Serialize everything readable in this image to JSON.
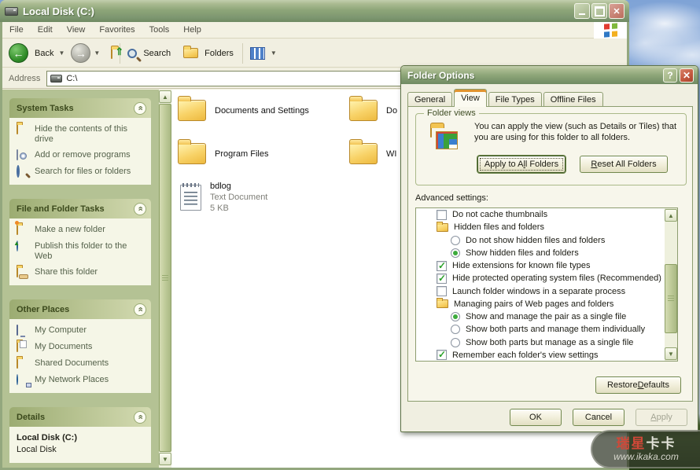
{
  "window": {
    "title": "Local Disk (C:)",
    "menu": [
      "File",
      "Edit",
      "View",
      "Favorites",
      "Tools",
      "Help"
    ],
    "toolbar": {
      "back_label": "Back",
      "search_label": "Search",
      "folders_label": "Folders"
    },
    "address": {
      "label": "Address",
      "value": "C:\\"
    }
  },
  "sidebar": {
    "sections": [
      {
        "title": "System Tasks",
        "items": [
          {
            "label": "Hide the contents of this drive"
          },
          {
            "label": "Add or remove programs"
          },
          {
            "label": "Search for files or folders"
          }
        ]
      },
      {
        "title": "File and Folder Tasks",
        "items": [
          {
            "label": "Make a new folder"
          },
          {
            "label": "Publish this folder to the Web"
          },
          {
            "label": "Share this folder"
          }
        ]
      },
      {
        "title": "Other Places",
        "items": [
          {
            "label": "My Computer"
          },
          {
            "label": "My Documents"
          },
          {
            "label": "Shared Documents"
          },
          {
            "label": "My Network Places"
          }
        ]
      },
      {
        "title": "Details",
        "detail_title": "Local Disk (C:)",
        "detail_sub": "Local Disk"
      }
    ]
  },
  "files": {
    "tiles": [
      {
        "name": "Documents and Settings"
      },
      {
        "name": "Do"
      },
      {
        "name": "Program Files"
      },
      {
        "name": "WI"
      },
      {
        "name": "bdlog",
        "meta1": "Text Document",
        "meta2": "5 KB"
      }
    ]
  },
  "dialog": {
    "title": "Folder Options",
    "tabs": [
      {
        "label": "General"
      },
      {
        "label": "View"
      },
      {
        "label": "File Types"
      },
      {
        "label": "Offline Files"
      }
    ],
    "active_tab": "View",
    "folder_views": {
      "legend": "Folder views",
      "description": "You can apply the view (such as Details or Tiles) that you are using for this folder to all folders.",
      "apply_button": {
        "label": "Apply to All Folders",
        "accel_index": 10
      },
      "reset_button": {
        "label": "Reset All Folders",
        "accel_index": 0
      }
    },
    "advanced": {
      "label": "Advanced settings:",
      "items": [
        {
          "control": "checkbox",
          "checked": false,
          "level": 1,
          "label": "Do not cache thumbnails"
        },
        {
          "control": "folder",
          "level": 1,
          "label": "Hidden files and folders"
        },
        {
          "control": "radio",
          "checked": false,
          "level": 2,
          "label": "Do not show hidden files and folders"
        },
        {
          "control": "radio",
          "checked": true,
          "level": 2,
          "label": "Show hidden files and folders"
        },
        {
          "control": "checkbox",
          "checked": true,
          "level": 1,
          "label": "Hide extensions for known file types"
        },
        {
          "control": "checkbox",
          "checked": true,
          "level": 1,
          "label": "Hide protected operating system files (Recommended)"
        },
        {
          "control": "checkbox",
          "checked": false,
          "level": 1,
          "label": "Launch folder windows in a separate process"
        },
        {
          "control": "folder",
          "level": 1,
          "label": "Managing pairs of Web pages and folders"
        },
        {
          "control": "radio",
          "checked": true,
          "level": 2,
          "label": "Show and manage the pair as a single file"
        },
        {
          "control": "radio",
          "checked": false,
          "level": 2,
          "label": "Show both parts and manage them individually"
        },
        {
          "control": "radio",
          "checked": false,
          "level": 2,
          "label": "Show both parts but manage as a single file"
        },
        {
          "control": "checkbox",
          "checked": true,
          "level": 1,
          "label": "Remember each folder's view settings"
        }
      ]
    },
    "buttons": {
      "restore": {
        "label": "Restore Defaults",
        "accel_index": 8
      },
      "ok": {
        "label": "OK"
      },
      "cancel": {
        "label": "Cancel"
      },
      "apply": {
        "label": "Apply",
        "accel_index": 0,
        "disabled": true
      }
    }
  },
  "watermark": {
    "brand_red": "瑞星",
    "brand_white": "卡卡",
    "url": "www.ikaka.com"
  },
  "colors": {
    "titlebar_top": "#c3cfae",
    "titlebar_mid": "#8ea679",
    "titlebar_bottom": "#6f8a62",
    "window_chrome": "#f0eede",
    "window_border": "#93a77e",
    "sidebar_bg": "#b4c294",
    "section_header_left": "#9cac72",
    "section_header_right": "#d4dbb2",
    "section_title": "#3b491c",
    "section_body": "#f5f6e7",
    "task_link": "#55624b",
    "dialog_bg": "#f0efe1",
    "panel_bg": "#f7f6eb",
    "panel_border": "#8d9d70",
    "tab_accent": "#e0932f",
    "button_border": "#71884e",
    "check_green": "#2aa12a",
    "radio_green": "#3cab3c",
    "close_red": "#c2563c",
    "scroll_thumb": "#bfcb99",
    "folder_yellow": "#f6cd5e",
    "watermark_red": "#d04838"
  }
}
